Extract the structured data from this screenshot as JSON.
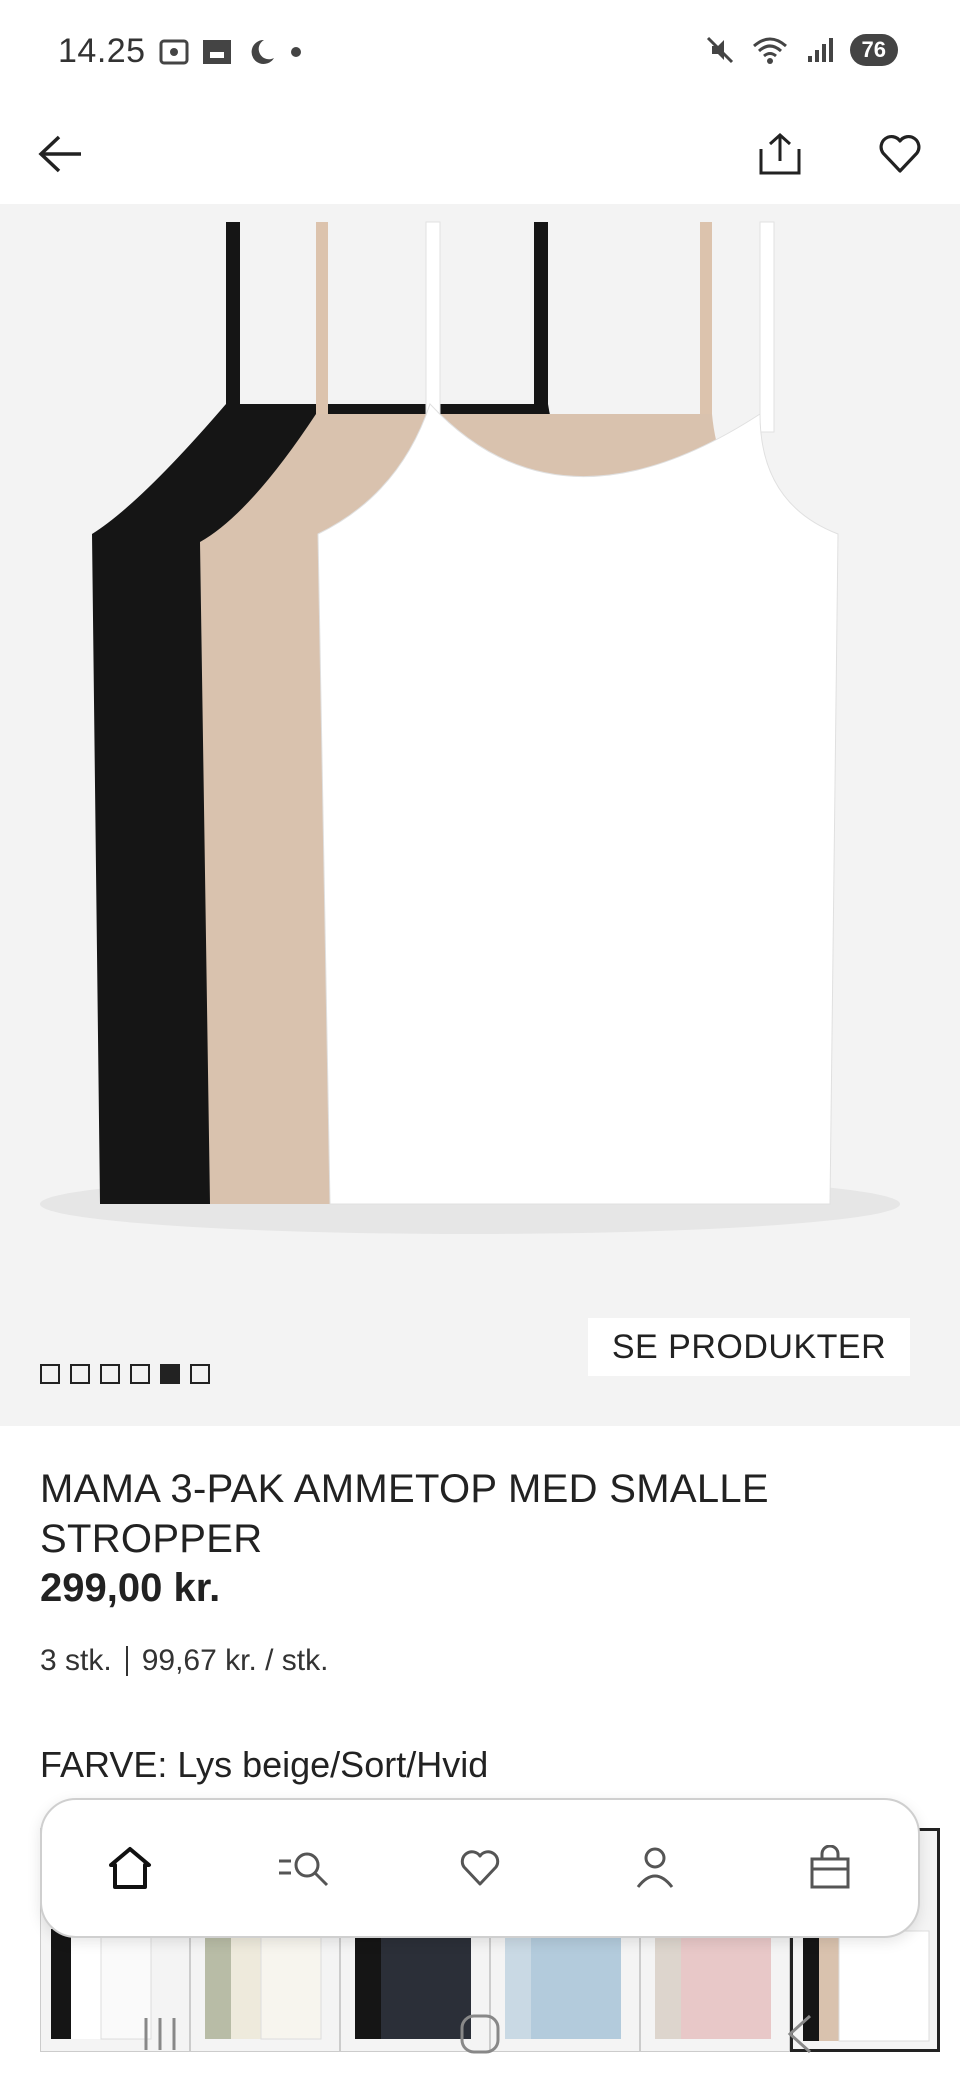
{
  "status_bar": {
    "time": "14.25",
    "battery": "76"
  },
  "icons": {
    "back": "arrow-left-icon",
    "share": "share-icon",
    "favorite": "heart-icon",
    "home": "home-icon",
    "search": "search-icon",
    "wishlist": "heart-icon",
    "account": "user-icon",
    "bag": "shopping-bag-icon"
  },
  "hero": {
    "cta_label": "SE PRODUKTER",
    "carousel_count": 6,
    "carousel_active_index": 4
  },
  "product": {
    "title": "MAMA 3-PAK AMMETOP MED SMALLE STROPPER",
    "price": "299,00 kr.",
    "pack_count": "3 stk.",
    "unit_price": "99,67 kr. / stk.",
    "color_label": "FARVE:",
    "color_value": "Lys beige/Sort/Hvid"
  },
  "colors": {
    "text": "#222222",
    "hero_bg": "#f3f3f3",
    "black_top": "#151515",
    "beige_top": "#d9c2ae",
    "white_top": "#ffffff"
  },
  "thumbnails": [
    {
      "name": "black-white-variant",
      "selected": false
    },
    {
      "name": "green-cream-variant",
      "selected": false
    },
    {
      "name": "navy-black-variant",
      "selected": false
    },
    {
      "name": "light-blue-variant",
      "selected": false
    },
    {
      "name": "pink-beige-variant",
      "selected": false
    },
    {
      "name": "beige-black-white-variant",
      "selected": true
    }
  ]
}
